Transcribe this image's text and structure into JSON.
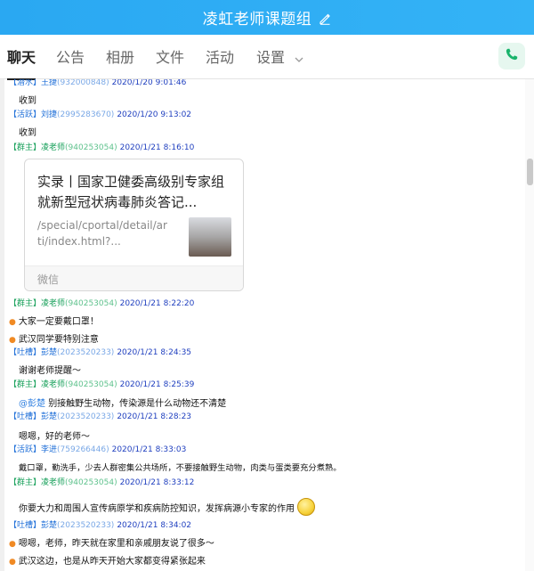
{
  "header": {
    "title": "凌虹老师课题组",
    "edit_icon": "edit-pencil-icon"
  },
  "tabs": [
    {
      "label": "聊天",
      "active": true
    },
    {
      "label": "公告"
    },
    {
      "label": "相册"
    },
    {
      "label": "文件"
    },
    {
      "label": "活动"
    },
    {
      "label": "设置"
    }
  ],
  "call_icon": "phone-icon",
  "messages": [
    {
      "role": "【潜水】",
      "nick": "王捷",
      "uid": "(932000848)",
      "time": "2020/1/20 9:01:46",
      "lines": [
        "收到"
      ]
    },
    {
      "role": "【活跃】",
      "nick": "刘捷",
      "uid": "(2995283670)",
      "time": "2020/1/20 9:13:02",
      "lines": [
        "收到"
      ]
    },
    {
      "role": "【群主】",
      "nick": "凌老师",
      "uid": "(940253054)",
      "time": "2020/1/21 8:16:10",
      "lines": []
    },
    {
      "role": "【群主】",
      "nick": "凌老师",
      "uid": "(940253054)",
      "time": "2020/1/21 8:22:20",
      "lines": [
        "大家一定要戴口罩！",
        "武汉同学要特别注意"
      ]
    },
    {
      "role": "【吐槽】",
      "nick": "彭楚",
      "uid": "(2023520233)",
      "time": "2020/1/21 8:24:35",
      "lines": [
        "谢谢老师提醒～"
      ]
    },
    {
      "role": "【群主】",
      "nick": "凌老师",
      "uid": "(940253054)",
      "time": "2020/1/21 8:25:39",
      "mention": "@彭楚",
      "lines": [
        "别接触野生动物，传染源是什么动物还不清楚"
      ]
    },
    {
      "role": "【吐槽】",
      "nick": "彭楚",
      "uid": "(2023520233)",
      "time": "2020/1/21 8:28:23",
      "lines": [
        "嗯嗯，好的老师～"
      ]
    },
    {
      "role": "【活跃】",
      "nick": "李进",
      "uid": "(759266446)",
      "time": "2020/1/21 8:33:03",
      "lines": [
        "戴口罩，勤洗手，少去人群密集公共场所，不要接触野生动物，肉类与蛋类要充分煮熟。"
      ]
    },
    {
      "role": "【群主】",
      "nick": "凌老师",
      "uid": "(940253054)",
      "time": "2020/1/21 8:33:12",
      "lines": [
        "你要大力和周围人宣传病原学和疾病防控知识，发挥病源小专家的作用"
      ]
    },
    {
      "role": "【吐槽】",
      "nick": "彭楚",
      "uid": "(2023520233)",
      "time": "2020/1/21 8:34:02",
      "lines": [
        "嗯嗯，老师，昨天就在家里和亲戚朋友说了很多～",
        "武汉这边，也是从昨天开始大家都变得紧张起来"
      ]
    }
  ],
  "share_card": {
    "title": "实录丨国家卫健委高级别专家组就新型冠状病毒肺炎答记...",
    "url": "/special/cportal/detail/arti/index.html?...",
    "source": "微信"
  },
  "emoji": "smiley-face-icon",
  "colors": {
    "header": "#2aa8f2",
    "group_owner": "#17a05a",
    "member": "#1f6fd8",
    "timestamp": "#1f3fbf",
    "bullet": "#f08a24",
    "call": "#19b36b"
  }
}
